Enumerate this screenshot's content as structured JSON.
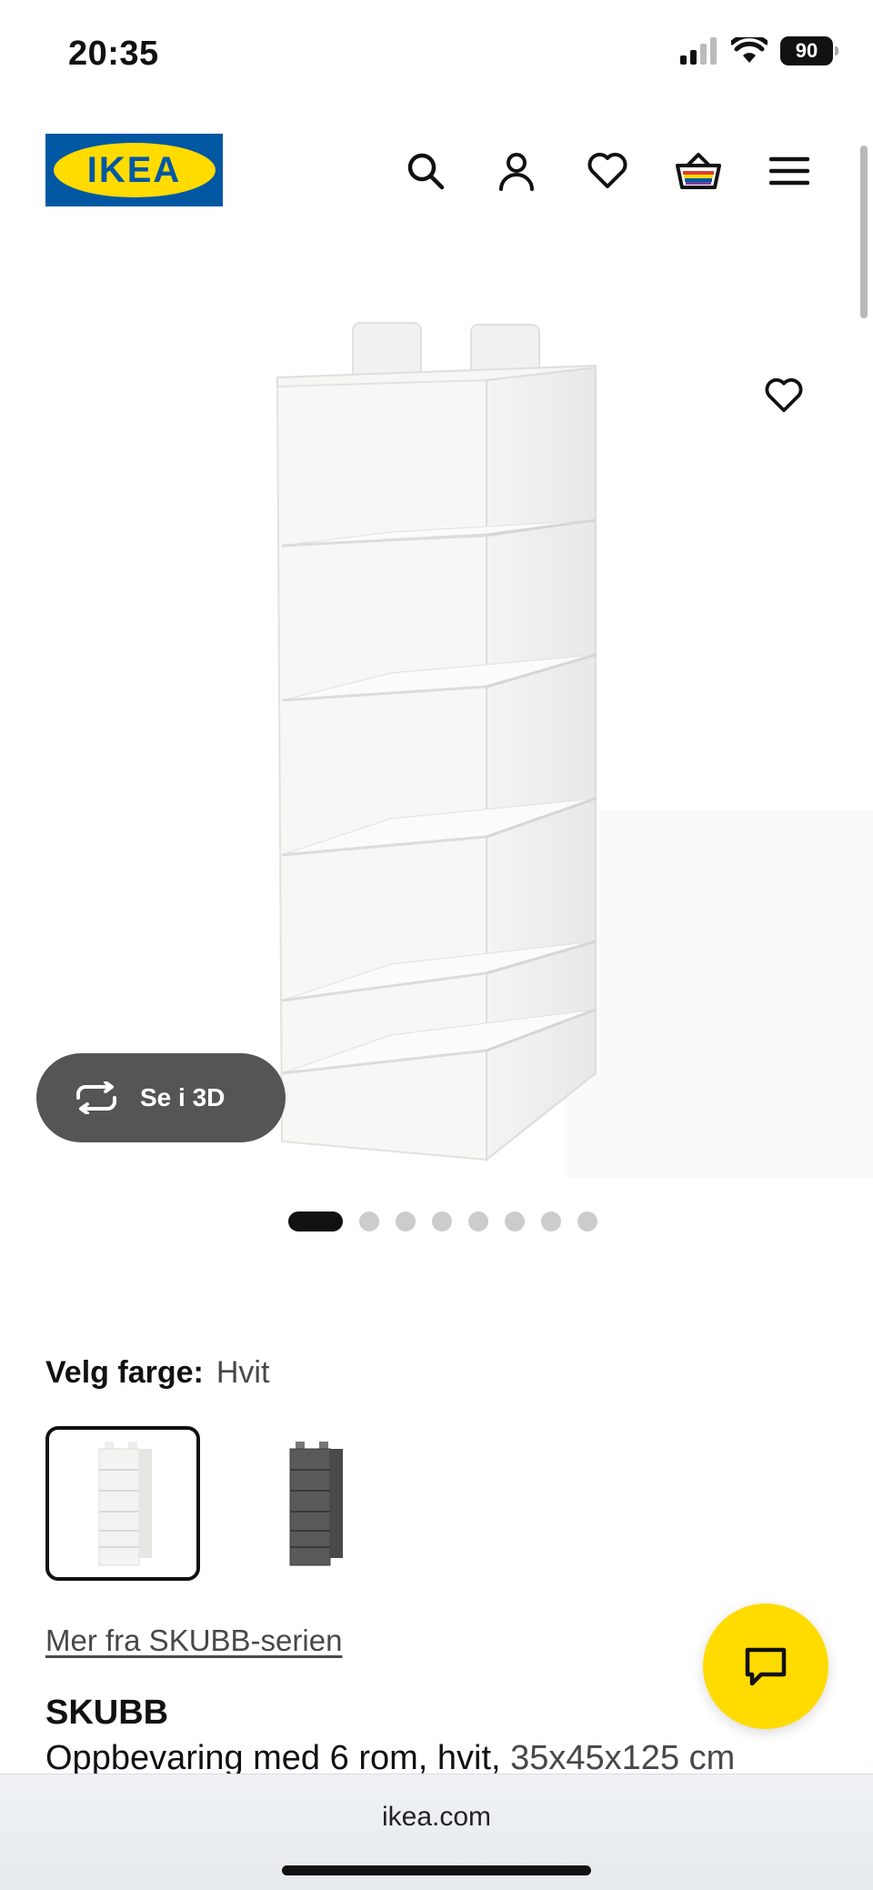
{
  "status_bar": {
    "time": "20:35",
    "battery": "90"
  },
  "header": {
    "logo_text": "IKEA",
    "icons": [
      "search-icon",
      "account-icon",
      "heart-icon",
      "basket-icon",
      "menu-icon"
    ]
  },
  "media": {
    "see_3d_label": "Se i 3D",
    "dot_count": 8,
    "active_dot": 0
  },
  "color": {
    "label": "Velg farge:",
    "value": "Hvit",
    "swatches": [
      "white",
      "dark-grey"
    ]
  },
  "product": {
    "series_link": "Mer fra SKUBB-serien",
    "name": "SKUBB",
    "description": "Oppbevaring med 6 rom, hvit,",
    "dimensions": "35x45x125 cm"
  },
  "browser": {
    "url": "ikea.com"
  },
  "colors": {
    "brand_blue": "#0058a3",
    "brand_yellow": "#ffdb00",
    "button_grey": "#555555"
  }
}
